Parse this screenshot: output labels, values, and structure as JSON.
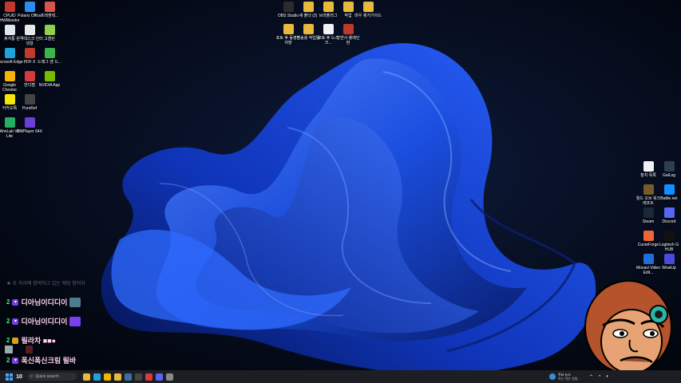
{
  "desktop": {
    "left_icons": [
      {
        "label": "CPUID HWMonitor",
        "icon": "cpuid-icon",
        "color": "#c0392b"
      },
      {
        "label": "Polaris Office",
        "icon": "polaris-office-icon",
        "color": "#2d8cf0"
      },
      {
        "label": "프레젠테...",
        "icon": "presentation-icon",
        "color": "#d9534f"
      },
      {
        "label": "휴지통",
        "icon": "recycle-bin-icon",
        "color": "#dfe6ee"
      },
      {
        "label": "원격데스크 인터넷끊",
        "icon": "remote-desktop-icon",
        "color": "#e8e8e8"
      },
      {
        "label": "고클린",
        "icon": "goclean-icon",
        "color": "#8fd14f"
      },
      {
        "label": "Microsoft Edge",
        "icon": "edge-icon",
        "color": "#1fa3d9"
      },
      {
        "label": "PDF X",
        "icon": "pdf-x-icon",
        "color": "#c0392b"
      },
      {
        "label": "드래그 앤 드...",
        "icon": "drag-drop-icon",
        "color": "#3cb44b"
      },
      {
        "label": "Google Chrome",
        "icon": "chrome-icon",
        "color": "#f4b400"
      },
      {
        "label": "반디캠",
        "icon": "bandicam-icon",
        "color": "#d63a3a"
      },
      {
        "label": "NVIDIA App",
        "icon": "nvidia-icon",
        "color": "#76b900"
      },
      {
        "label": "카카오톡",
        "icon": "kakaotalk-icon",
        "color": "#f7e600"
      },
      {
        "label": "PureRef",
        "icon": "pureref-icon",
        "color": "#444444"
      },
      {
        "label": "AhnLab V3 Lite",
        "icon": "ahnlab-icon",
        "color": "#27ae60"
      },
      {
        "label": "KMPlayer 64X",
        "icon": "kmplayer-icon",
        "color": "#6a3fd6"
      }
    ],
    "top_icons": [
      {
        "label": "OBS Studio",
        "icon": "obs-icon",
        "color": "#2b2b2b"
      },
      {
        "label": "새 폴더 (2)",
        "icon": "folder-icon",
        "color": "#e8b93a"
      },
      {
        "label": "브라플러그",
        "icon": "folder-icon",
        "color": "#e8b93a"
      },
      {
        "label": "작업",
        "icon": "folder-icon",
        "color": "#e8b93a"
      },
      {
        "label": "마우 제거기이드",
        "icon": "folder-icon",
        "color": "#e8b93a"
      },
      {
        "label": "포토 후 동영진 저장",
        "icon": "folder-icon",
        "color": "#e8b93a"
      },
      {
        "label": "방송용 작업물",
        "icon": "folder-icon",
        "color": "#e8b93a"
      },
      {
        "label": "포토 후 드스크...",
        "icon": "document-icon",
        "color": "#f2f2f2"
      },
      {
        "label": "방연사 플래인 판",
        "icon": "shortcut-icon",
        "color": "#c0392b"
      }
    ],
    "right_icons": [
      {
        "label": "참치 목록",
        "icon": "document-icon",
        "color": "#f2f2f2"
      },
      {
        "label": "GalLog",
        "icon": "gallog-icon",
        "color": "#2c3e50"
      },
      {
        "label": "월드 오브 워크래프트",
        "icon": "wow-icon",
        "color": "#7a5a2a"
      },
      {
        "label": "Battle.net",
        "icon": "battlenet-icon",
        "color": "#148eff"
      },
      {
        "label": "Steam",
        "icon": "steam-icon",
        "color": "#1b2838"
      },
      {
        "label": "Discord",
        "icon": "discord-icon",
        "color": "#5865f2"
      },
      {
        "label": "CurseForge",
        "icon": "curseforge-icon",
        "color": "#f16436"
      },
      {
        "label": "Logitech G HUB",
        "icon": "logitech-icon",
        "color": "#111111"
      },
      {
        "label": "Movavi Video Edit...",
        "icon": "movavi-icon",
        "color": "#1e6fd9"
      },
      {
        "label": "WowUp",
        "icon": "wowup-icon",
        "color": "#4a4ad9"
      }
    ]
  },
  "chat": {
    "header": "★ 초 자리에 참여하고 있는 채팅 참여자",
    "messages": [
      {
        "count": "2",
        "name": "디아님이디디이",
        "sticker": "#4b7b8c"
      },
      {
        "count": "2",
        "name": "디아님이디디이",
        "sticker": "#7b3ff2"
      },
      {
        "count": "2",
        "name": "릴라차 ■■●",
        "sticker": ""
      },
      {
        "count": "2",
        "name": "폭신폭신크림 릴바",
        "sticker": ""
      }
    ],
    "side_count": "10"
  },
  "taskbar": {
    "search_placeholder": "Quick search",
    "news_title": "주요 뉴스",
    "news_sub": "하는 작은 경험...",
    "apps": [
      "file-explorer-icon",
      "edge-icon",
      "chrome-icon",
      "folder-icon",
      "steam-icon",
      "obs-icon",
      "bandicam-icon",
      "discord-icon",
      "settings-icon"
    ]
  },
  "colors": {
    "wallpaper_bg": "#050a18",
    "ribbon_dark": "#0b2a9a",
    "ribbon_mid": "#1b4fe0",
    "ribbon_light": "#4f86ff",
    "taskbar": "#1c1e24"
  }
}
